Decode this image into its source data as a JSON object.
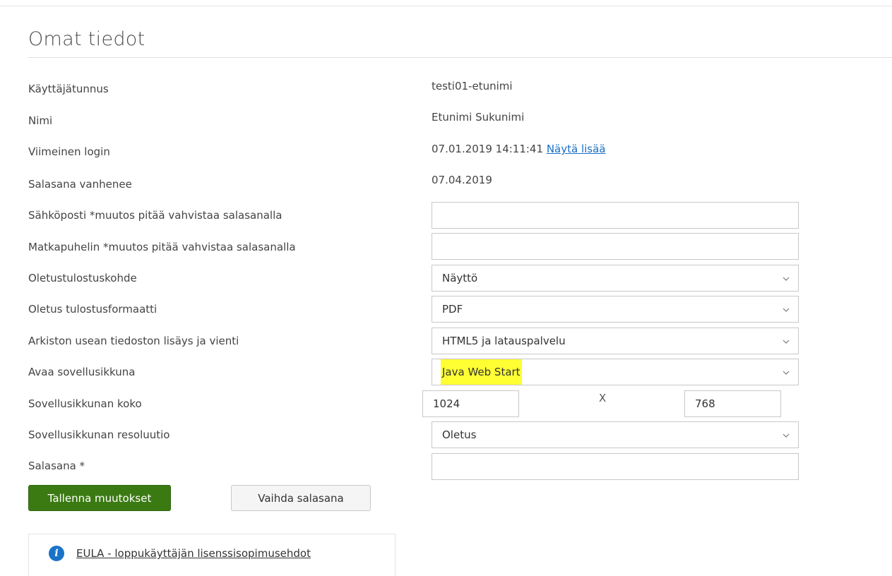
{
  "page": {
    "title": "Omat tiedot"
  },
  "fields": {
    "username": {
      "label": "Käyttäjätunnus",
      "value": "testi01-etunimi"
    },
    "name": {
      "label": "Nimi",
      "value": "Etunimi Sukunimi"
    },
    "last_login": {
      "label": "Viimeinen login",
      "value": "07.01.2019 14:11:41",
      "link": "Näytä lisää"
    },
    "password_expires": {
      "label": "Salasana vanhenee",
      "value": "07.04.2019"
    },
    "email": {
      "label": "Sähköposti *muutos pitää vahvistaa salasanalla",
      "value": ""
    },
    "mobile": {
      "label": "Matkapuhelin *muutos pitää vahvistaa salasanalla",
      "value": ""
    },
    "default_output": {
      "label": "Oletustulostuskohde",
      "selected": "Näyttö"
    },
    "default_format": {
      "label": "Oletus tulostusformaatti",
      "selected": "PDF"
    },
    "archive_transfer": {
      "label": "Arkiston usean tiedoston lisäys ja vienti",
      "selected": "HTML5 ja latauspalvelu"
    },
    "open_app_window": {
      "label": "Avaa sovellusikkuna",
      "selected": "Java Web Start",
      "highlight_color": "#ffff33"
    },
    "window_size": {
      "label": "Sovellusikkunan koko",
      "width": "1024",
      "separator": "X",
      "height": "768"
    },
    "window_resolution": {
      "label": "Sovellusikkunan resoluutio",
      "selected": "Oletus"
    },
    "password": {
      "label": "Salasana *",
      "value": ""
    }
  },
  "buttons": {
    "save": "Tallenna muutokset",
    "change_password": "Vaihda salasana"
  },
  "info": {
    "link": "EULA - loppukäyttäjän lisenssisopimusehdot"
  },
  "colors": {
    "primary_button": "#3b7a13",
    "link": "#1a6fc9",
    "info_icon": "#1a73c8"
  }
}
